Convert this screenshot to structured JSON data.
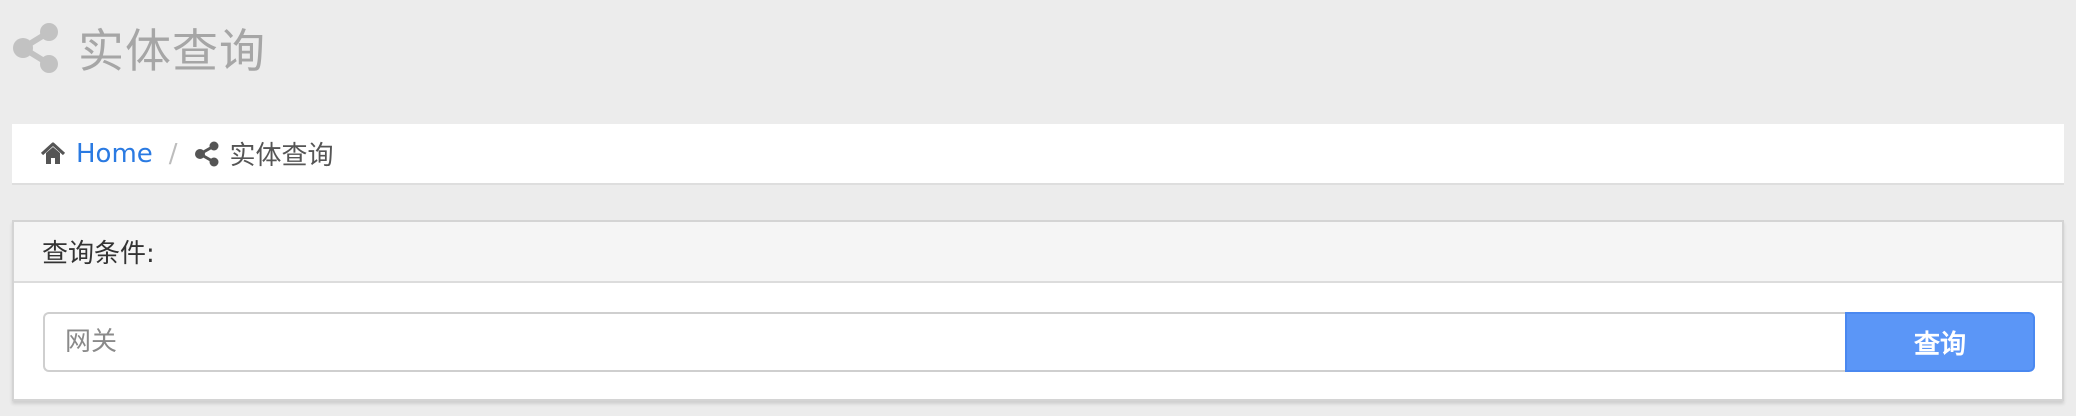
{
  "header": {
    "icon": "share-alt-icon",
    "title": "实体查询"
  },
  "breadcrumb": {
    "home_icon": "home-icon",
    "home_label": "Home",
    "separator": "/",
    "current_icon": "share-alt-icon",
    "current_label": "实体查询"
  },
  "panel": {
    "heading": "查询条件:",
    "search": {
      "value": "",
      "placeholder": "网关"
    },
    "button_label": "查询"
  },
  "colors": {
    "background": "#ececec",
    "link": "#2a7ae2",
    "button": "#5b96f7",
    "header_text": "#a6a6a6"
  }
}
